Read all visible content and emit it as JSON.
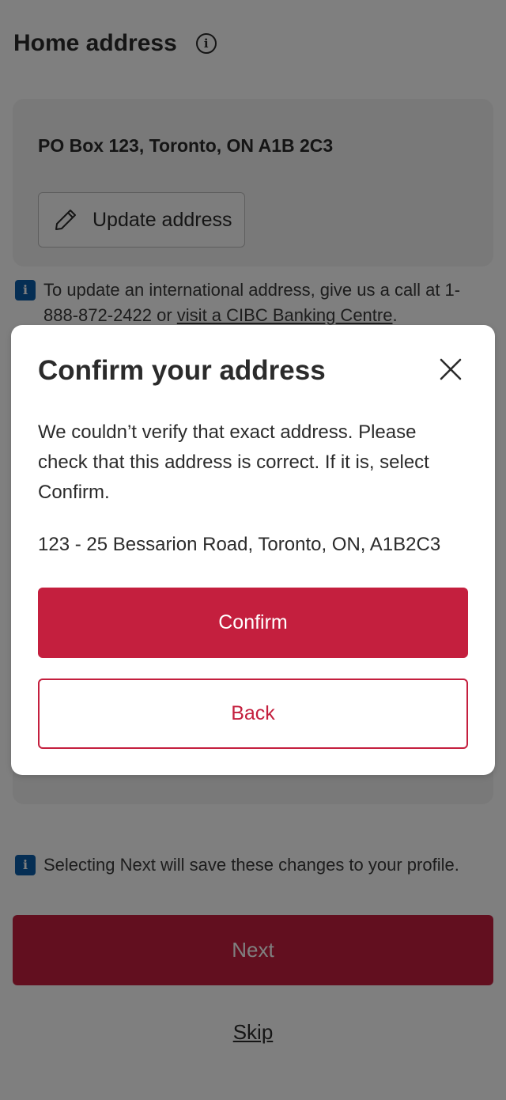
{
  "page": {
    "title": "Home address",
    "info_icon": "info-circle-icon"
  },
  "address_card": {
    "current_address": "PO Box 123, Toronto, ON A1B 2C3",
    "update_button_label": "Update address",
    "update_icon": "pencil-icon"
  },
  "international_note": {
    "text": "To update an international address, give us a call at 1-888-872-2422 or ",
    "link": "visit a CIBC Banking Centre",
    "after_link": "."
  },
  "save_note": {
    "text": "Selecting Next will save these changes to your profile."
  },
  "next_button": {
    "label": "Next"
  },
  "skip_link": {
    "label": "Skip"
  },
  "modal": {
    "title": "Confirm your address",
    "body": "We couldn’t verify that exact address. Please check that this address is correct. If it is, select Confirm.",
    "suggested_address": "123 - 25 Bessarion Road, Toronto, ON, A1B2C3",
    "confirm_label": "Confirm",
    "back_label": "Back",
    "close_icon": "close-icon"
  },
  "colors": {
    "brand_red": "#c41f3e",
    "info_blue": "#0b5da8",
    "scrim": "rgba(0,0,0,0.5)"
  }
}
